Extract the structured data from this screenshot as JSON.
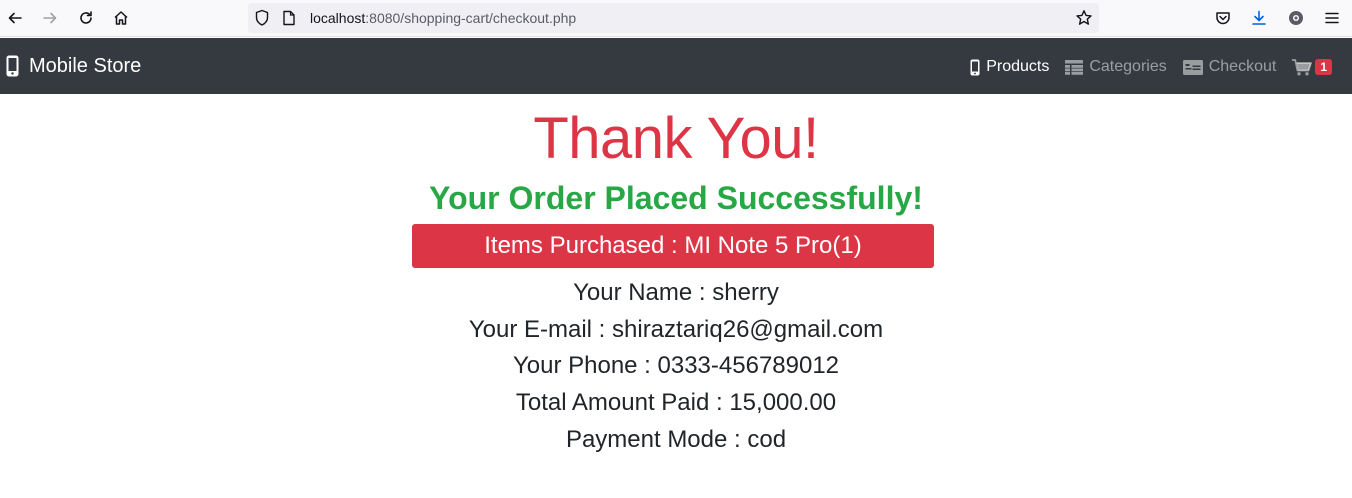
{
  "browser": {
    "url_host": "localhost",
    "url_rest": ":8080/shopping-cart/checkout.php"
  },
  "navbar": {
    "brand": "Mobile Store",
    "links": [
      {
        "label": "Products",
        "icon": "mobile-phone-icon"
      },
      {
        "label": "Categories",
        "icon": "table-icon"
      },
      {
        "label": "Checkout",
        "icon": "money-bill-icon"
      }
    ],
    "cart_count": "1"
  },
  "order": {
    "heading": "Thank You!",
    "subheading": "Your Order Placed Successfully!",
    "items_purchased": "Items Purchased : MI Note 5 Pro(1)",
    "name_line": "Your Name : sherry",
    "email_line": "Your E-mail : shiraztariq26@gmail.com",
    "phone_line": "Your Phone : 0333-456789012",
    "amount_line": "Total Amount Paid : 15,000.00",
    "payment_line": "Payment Mode : cod"
  },
  "colors": {
    "navbar_bg": "#343a40",
    "danger": "#dc3545",
    "success": "#28a745",
    "text": "#212529"
  }
}
